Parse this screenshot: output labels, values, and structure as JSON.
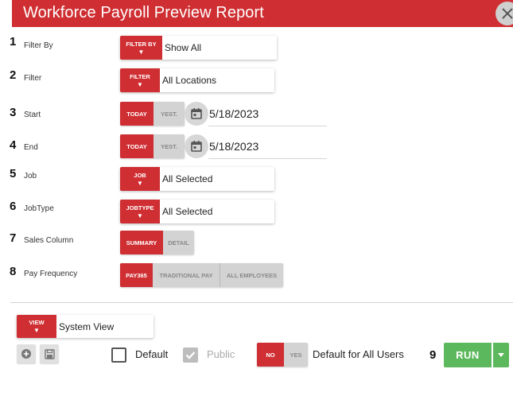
{
  "dialog": {
    "title": "Workforce Payroll Preview Report"
  },
  "rows": [
    {
      "num": "1",
      "label": "Filter By",
      "button": "FILTER BY",
      "value": "Show All"
    },
    {
      "num": "2",
      "label": "Filter",
      "button": "FILTER",
      "value": "All Locations"
    },
    {
      "num": "3",
      "label": "Start",
      "opt_today": "TODAY",
      "opt_yest": "YEST.",
      "value": "5/18/2023"
    },
    {
      "num": "4",
      "label": "End",
      "opt_today": "TODAY",
      "opt_yest": "YEST.",
      "value": "5/18/2023"
    },
    {
      "num": "5",
      "label": "Job",
      "button": "JOB",
      "value": "All Selected"
    },
    {
      "num": "6",
      "label": "JobType",
      "button": "JOBTYPE",
      "value": "All Selected"
    },
    {
      "num": "7",
      "label": "Sales Column",
      "opt_a": "SUMMARY",
      "opt_b": "DETAIL"
    },
    {
      "num": "8",
      "label": "Pay Frequency",
      "opt_a": "PAY365",
      "opt_b": "TRADITIONAL PAY",
      "opt_c": "ALL EMPLOYEES"
    }
  ],
  "view": {
    "button": "VIEW",
    "value": "System View"
  },
  "options": {
    "default_label": "Default",
    "public_label": "Public",
    "all_users_no": "NO",
    "all_users_yes": "YES",
    "all_users_label": "Default for All Users"
  },
  "run": {
    "num": "9",
    "label": "RUN"
  },
  "colors": {
    "accent_red": "#cf2e32",
    "run_green": "#5cb85c"
  },
  "icons": {
    "close": "close-icon",
    "calendar": "calendar-icon",
    "add": "add-circle-icon",
    "save": "save-icon",
    "dropdown": "caret-down-icon"
  }
}
